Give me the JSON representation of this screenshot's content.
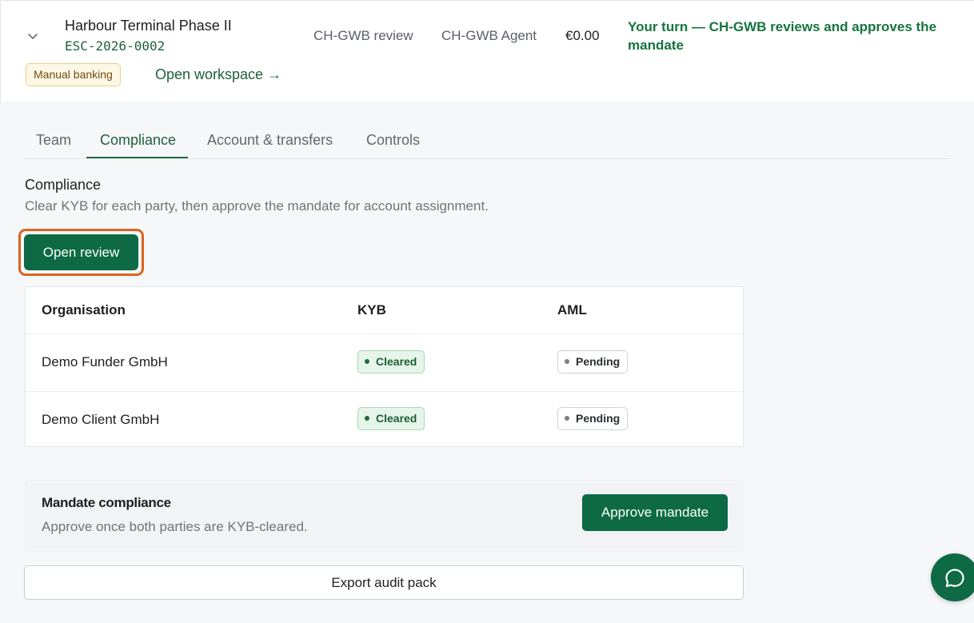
{
  "header": {
    "project_title": "Harbour Terminal Phase II",
    "project_code": "ESC-2026-0002",
    "stage": "CH-GWB review",
    "agent": "CH-GWB Agent",
    "amount": "€0.00",
    "turn_message": "Your turn — CH-GWB reviews and approves the mandate",
    "banking_badge": "Manual banking",
    "open_workspace": "Open workspace →",
    "icons": {
      "expand": "chevron-down-icon"
    }
  },
  "tabs": [
    {
      "label": "Team",
      "active": false
    },
    {
      "label": "Compliance",
      "active": true
    },
    {
      "label": "Account & transfers",
      "active": false
    },
    {
      "label": "Controls",
      "active": false
    }
  ],
  "compliance": {
    "title": "Compliance",
    "subtitle": "Clear KYB for each party, then approve the mandate for account assignment.",
    "open_review": "Open review",
    "table": {
      "headers": [
        "Organisation",
        "KYB",
        "AML"
      ],
      "rows": [
        {
          "organisation": "Demo Funder GmbH",
          "kyb": "Cleared",
          "aml": "Pending"
        },
        {
          "organisation": "Demo Client GmbH",
          "kyb": "Cleared",
          "aml": "Pending"
        }
      ]
    }
  },
  "mandate": {
    "title": "Mandate compliance",
    "subtitle": "Approve once both parties are KYB-cleared.",
    "approve_button": "Approve mandate"
  },
  "export_button": "Export audit pack",
  "chat": {
    "icon": "chat-bubble-icon"
  },
  "colors": {
    "brand_green": "#0d6a45",
    "link_green": "#1f5e3c",
    "focus_ring": "#d9641f",
    "cleared_bg": "#e6f4ea",
    "manual_badge_bg": "#fdf7e6"
  }
}
